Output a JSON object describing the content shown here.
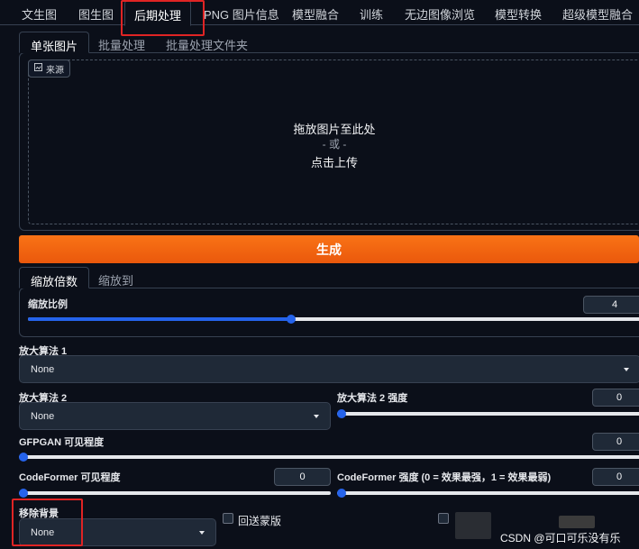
{
  "top_tabs": [
    {
      "label": "文生图"
    },
    {
      "label": "图生图"
    },
    {
      "label": "后期处理"
    },
    {
      "label": "PNG 图片信息"
    },
    {
      "label": "模型融合"
    },
    {
      "label": "训练"
    },
    {
      "label": "无边图像浏览"
    },
    {
      "label": "模型转换"
    },
    {
      "label": "超级模型融合"
    }
  ],
  "input_tabs": [
    {
      "label": "单张图片"
    },
    {
      "label": "批量处理"
    },
    {
      "label": "批量处理文件夹"
    }
  ],
  "dropzone": {
    "source_label": "来源",
    "line1": "拖放图片至此处",
    "line2": "- 或 -",
    "line3": "点击上传"
  },
  "generate_label": "生成",
  "resize_tabs": [
    {
      "label": "缩放倍数"
    },
    {
      "label": "缩放到"
    }
  ],
  "scale": {
    "label": "缩放比例",
    "value": "4",
    "fraction": 0.43
  },
  "upscaler1": {
    "label": "放大算法 1",
    "value": "None"
  },
  "upscaler2": {
    "label": "放大算法 2",
    "value": "None"
  },
  "upscaler2_strength": {
    "label": "放大算法 2 强度",
    "value": "0",
    "fraction": 0
  },
  "gfpgan": {
    "label": "GFPGAN 可见程度",
    "value": "0",
    "fraction": 0
  },
  "codeformer_vis": {
    "label": "CodeFormer 可见程度",
    "value": "0",
    "fraction": 0
  },
  "codeformer_weight": {
    "label": "CodeFormer 强度 (0 = 效果最强，1 = 效果最弱)",
    "value": "0",
    "fraction": 0
  },
  "remove_bg": {
    "label": "移除背景",
    "value": "None"
  },
  "return_mask": {
    "label": "回送蒙版"
  },
  "watermark": "CSDN @可口可乐没有乐",
  "colors": {
    "accent": "#f97316",
    "slider": "#2563eb",
    "highlight": "#e02424"
  }
}
